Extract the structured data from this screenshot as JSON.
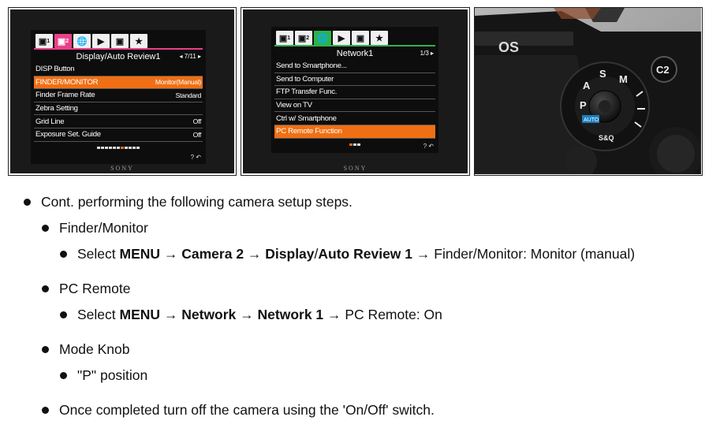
{
  "screen1": {
    "tabs": [
      "1",
      "2",
      "",
      "",
      "",
      ""
    ],
    "title": "Display/Auto Review1",
    "page": "◂ 7/11 ▸",
    "rows": [
      {
        "label": "DISP Button",
        "value": ""
      },
      {
        "label": "FINDER/MONITOR",
        "value": "Monitor(Manual)",
        "selected": true
      },
      {
        "label": "Finder Frame Rate",
        "value": "Standard"
      },
      {
        "label": "Zebra Setting",
        "value": ""
      },
      {
        "label": "Grid Line",
        "value": "Off"
      },
      {
        "label": "Exposure Set. Guide",
        "value": "Off"
      }
    ],
    "brand": "SONY"
  },
  "screen2": {
    "tabs": [
      "1",
      "2",
      "",
      "",
      "",
      ""
    ],
    "title": "Network1",
    "page": "1/3 ▸",
    "rows": [
      {
        "label": "Send to Smartphone...",
        "value": ""
      },
      {
        "label": "Send to Computer",
        "value": ""
      },
      {
        "label": "FTP Transfer Func.",
        "value": ""
      },
      {
        "label": "View on TV",
        "value": ""
      },
      {
        "label": "Ctrl w/ Smartphone",
        "value": ""
      },
      {
        "label": "PC Remote Function",
        "value": "",
        "selected": true
      }
    ],
    "brand": "SONY"
  },
  "camera_photo": {
    "dial_labels": [
      "M",
      "S",
      "A",
      "P",
      "AUTO",
      "S&Q"
    ],
    "button_label": "C2",
    "brand": "OS"
  },
  "text": {
    "b1": "Cont. performing the following camera setup steps.",
    "b2": "Finder/Monitor",
    "b3_pre": "Select ",
    "b3_bold1": "MENU → Camera 2 → Display",
    "b3_slash": "/",
    "b3_bold2": "Auto Review 1",
    "b3_post": " → Finder/Monitor: Monitor (manual)",
    "b4": "PC Remote",
    "b5_pre": "Select ",
    "b5_bold": "MENU → Network → Network 1",
    "b5_post": " → PC Remote: On",
    "b6": "Mode Knob",
    "b7": "\"P\" position",
    "b8": "Once completed turn off the camera using the 'On/Off' switch."
  }
}
